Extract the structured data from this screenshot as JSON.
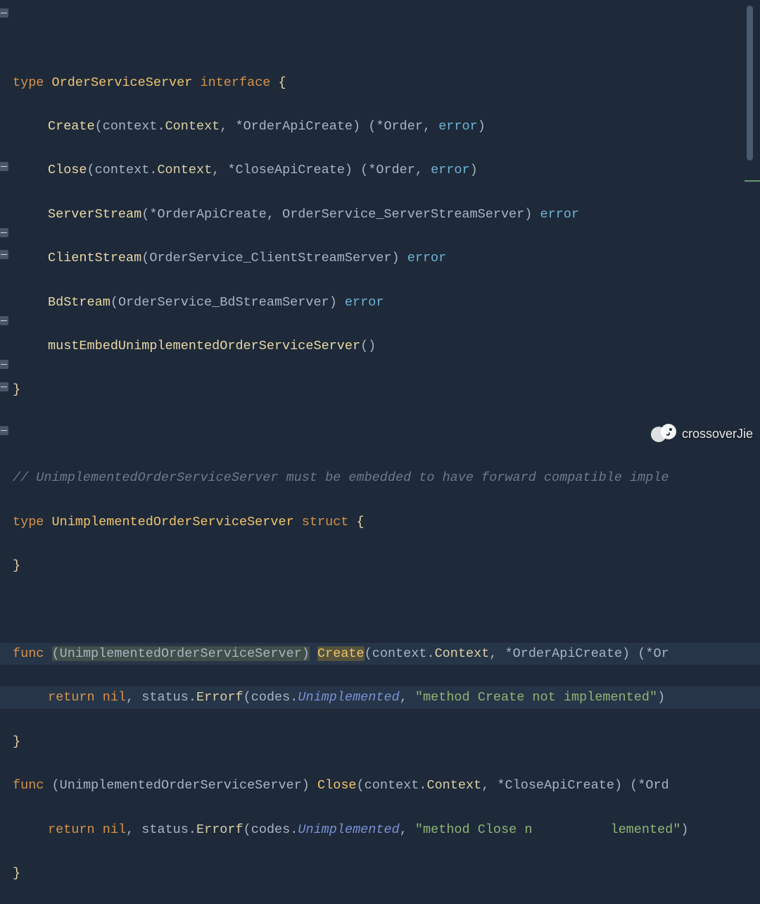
{
  "code": {
    "l1_kw_type": "type",
    "l1_name": "OrderServiceServer",
    "l1_kw_iface": "interface",
    "l1_brace": "{",
    "l2_fn": "Create",
    "l2_p1a": "context",
    "l2_p1b": "Context",
    "l2_p2": "*OrderApiCreate",
    "l2_r1": "*Order",
    "l2_r2": "error",
    "l3_fn": "Close",
    "l3_p1a": "context",
    "l3_p1b": "Context",
    "l3_p2": "*CloseApiCreate",
    "l3_r1": "*Order",
    "l3_r2": "error",
    "l4_fn": "ServerStream",
    "l4_p1": "*OrderApiCreate",
    "l4_p2": "OrderService_ServerStreamServer",
    "l4_r": "error",
    "l5_fn": "ClientStream",
    "l5_p1": "OrderService_ClientStreamServer",
    "l5_r": "error",
    "l6_fn": "BdStream",
    "l6_p1": "OrderService_BdStreamServer",
    "l6_r": "error",
    "l7_fn": "mustEmbedUnimplementedOrderServiceServer",
    "l8_brace": "}",
    "l10_comment": "// UnimplementedOrderServiceServer must be embedded to have forward compatible imple",
    "l11_kw_type": "type",
    "l11_name": "UnimplementedOrderServiceServer",
    "l11_kw_struct": "struct",
    "l11_brace": "{",
    "l12_brace": "}",
    "l14_kw_func": "func",
    "l14_recv": "UnimplementedOrderServiceServer",
    "l14_fn": "Create",
    "l14_p1a": "context",
    "l14_p1b": "Context",
    "l14_p2": "*OrderApiCreate",
    "l14_r1": "*Or",
    "l15_kw_return": "return",
    "l15_nil": "nil",
    "l15_pkg_status": "status",
    "l15_errorf": "Errorf",
    "l15_pkg_codes": "codes",
    "l15_unimpl": "Unimplemented",
    "l15_str": "\"method Create not implemented\"",
    "l16_brace": "}",
    "l17_kw_func": "func",
    "l17_recv": "UnimplementedOrderServiceServer",
    "l17_fn": "Close",
    "l17_p1a": "context",
    "l17_p1b": "Context",
    "l17_p2": "*CloseApiCreate",
    "l17_r1": "*Ord",
    "l18_kw_return": "return",
    "l18_nil": "nil",
    "l18_pkg_status": "status",
    "l18_errorf": "Errorf",
    "l18_pkg_codes": "codes",
    "l18_unimpl": "Unimplemented",
    "l18_str_a": "\"method Close n",
    "l18_str_b": "lemented\"",
    "l19_brace": "}"
  },
  "watermark": "crossoverJie"
}
